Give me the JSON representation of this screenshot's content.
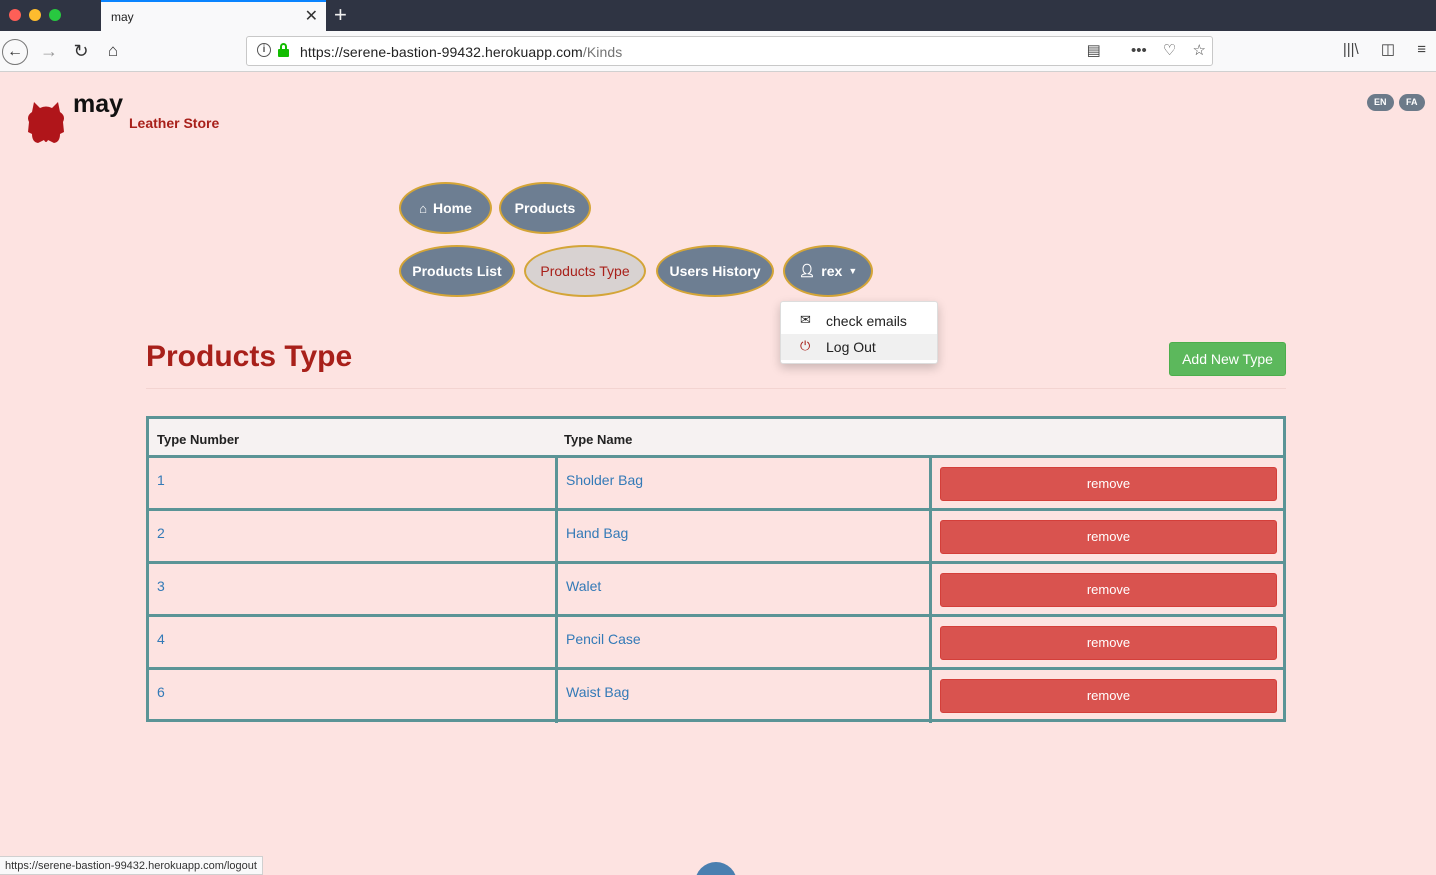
{
  "browser": {
    "tab_title": "may",
    "url_host": "https://serene-bastion-99432.herokuapp.com",
    "url_path": "/Kinds",
    "status_url": "https://serene-bastion-99432.herokuapp.com/logout"
  },
  "header": {
    "brand": "may",
    "tagline": "Leather Store",
    "languages": [
      "EN",
      "FA"
    ]
  },
  "nav": {
    "home": "Home",
    "products": "Products",
    "products_list": "Products List",
    "products_type": "Products Type",
    "users_history": "Users History",
    "user": "rex"
  },
  "user_menu": {
    "check_emails": "check emails",
    "log_out": "Log Out"
  },
  "main": {
    "title": "Products Type",
    "add_button": "Add New Type"
  },
  "table": {
    "headers": [
      "Type Number",
      "Type Name"
    ],
    "remove_label": "remove",
    "rows": [
      {
        "number": "1",
        "name": "Sholder Bag"
      },
      {
        "number": "2",
        "name": "Hand Bag"
      },
      {
        "number": "3",
        "name": "Walet"
      },
      {
        "number": "4",
        "name": "Pencil Case"
      },
      {
        "number": "6",
        "name": "Waist Bag"
      }
    ]
  },
  "colors": {
    "page_bg": "#fde3e1",
    "accent_red": "#a8201a",
    "pill": "#6d7e92",
    "pill_border": "#d4a537",
    "table_border": "#5b9496",
    "add_button": "#5cb85c",
    "remove_button": "#d9534f",
    "link": "#337ab7"
  }
}
